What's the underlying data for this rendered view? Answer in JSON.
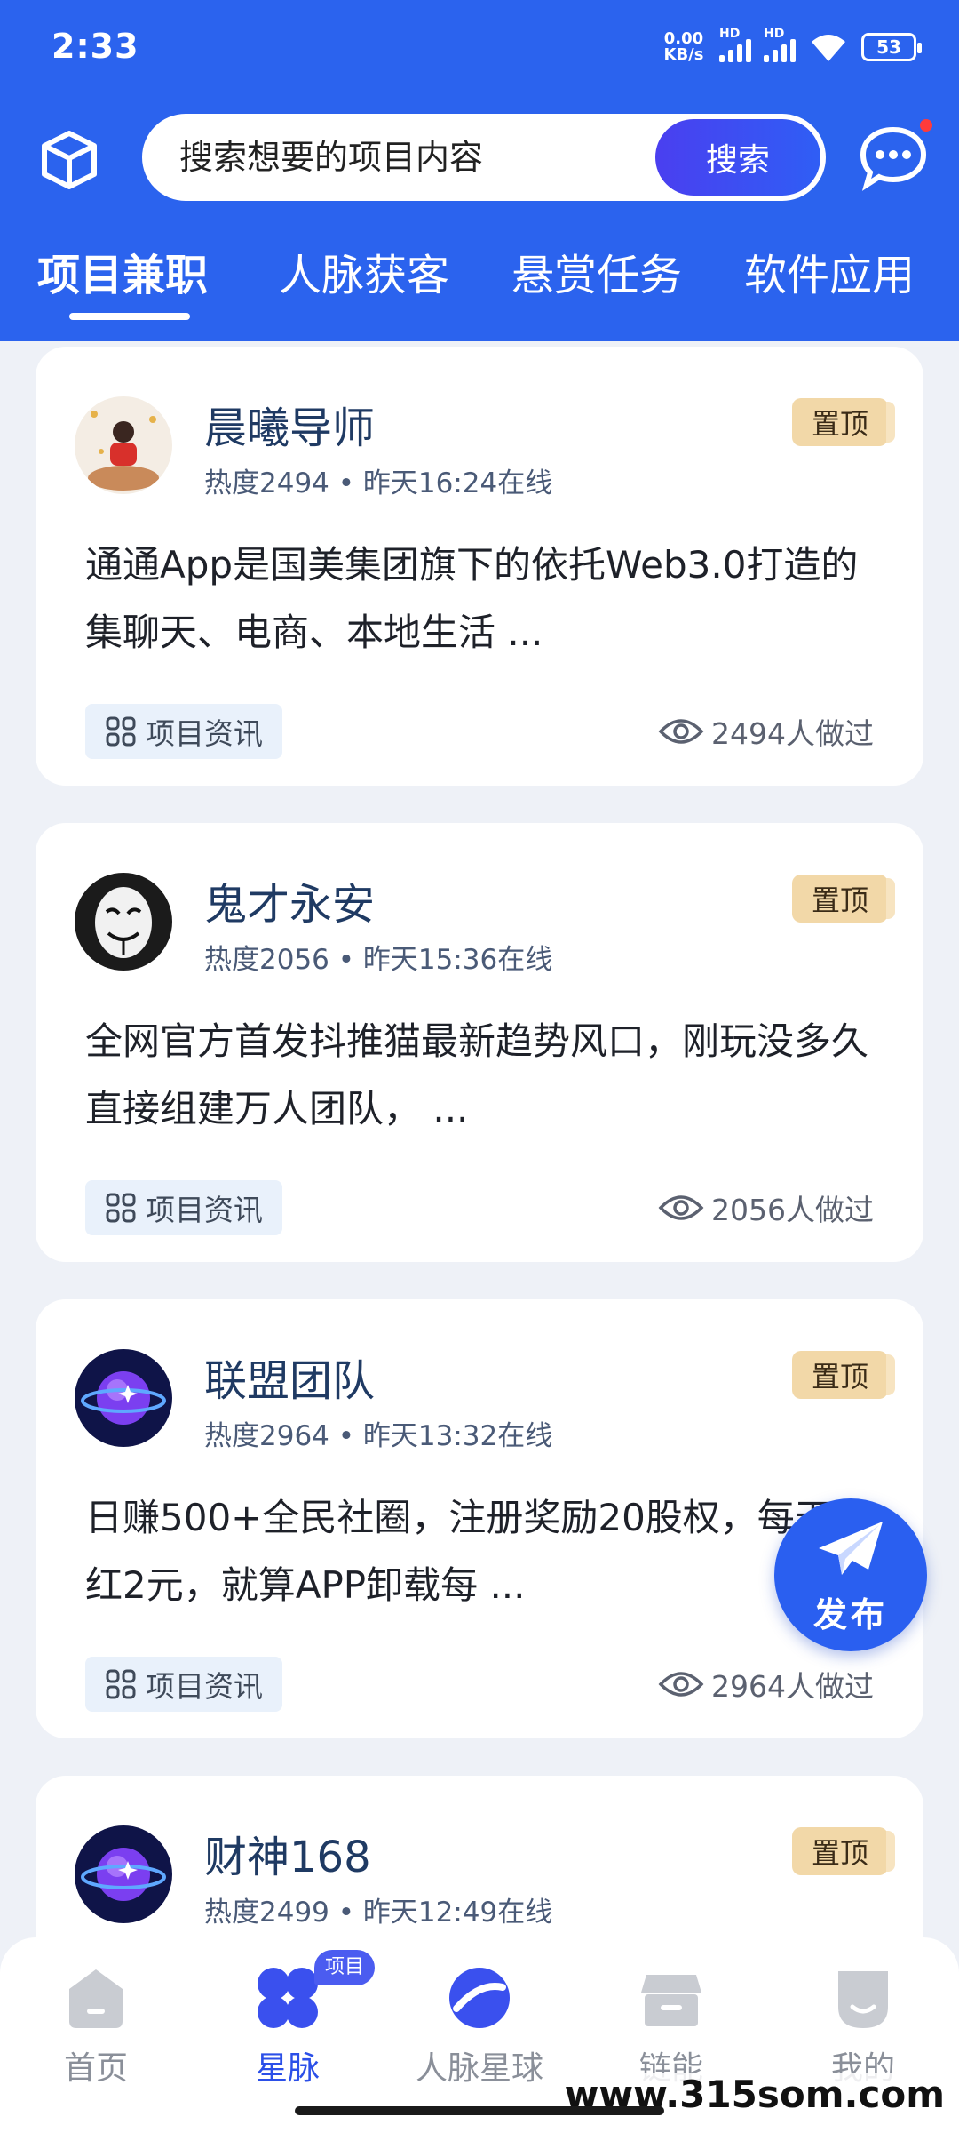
{
  "status_bar": {
    "time": "2:33",
    "netspeed_value": "0.00",
    "netspeed_unit": "KB/s",
    "signal_hd_1": "HD",
    "signal_hd_2": "HD",
    "battery": "53"
  },
  "search": {
    "placeholder": "搜索想要的项目内容",
    "button": "搜索"
  },
  "tabs": [
    {
      "label": "项目兼职"
    },
    {
      "label": "人脉获客"
    },
    {
      "label": "悬赏任务"
    },
    {
      "label": "软件应用"
    }
  ],
  "cards": [
    {
      "name": "晨曦导师",
      "meta": "热度2494 • 昨天16:24在线",
      "pin": "置顶",
      "desc": "通通App是国美集团旗下的依托Web3.0打造的集聊天、电商、本地生活 ...",
      "tag": "项目资讯",
      "views": "2494人做过"
    },
    {
      "name": "鬼才永安",
      "meta": "热度2056 • 昨天15:36在线",
      "pin": "置顶",
      "desc": "全网官方首发抖推猫最新趋势风口，刚玩没多久直接组建万人团队， ...",
      "tag": "项目资讯",
      "views": "2056人做过"
    },
    {
      "name": "联盟团队",
      "meta": "热度2964 • 昨天13:32在线",
      "pin": "置顶",
      "desc": "日赚500+全民社圈，注册奖励20股权，每天分红2元，就算APP卸载每 ...",
      "tag": "项目资讯",
      "views": "2964人做过"
    },
    {
      "name": "财神168",
      "meta": "热度2499 • 昨天12:49在线",
      "pin": "置顶"
    }
  ],
  "fab": {
    "label": "发布"
  },
  "bottom_nav": [
    {
      "label": "首页"
    },
    {
      "label": "星脉",
      "badge": "项目"
    },
    {
      "label": "人脉星球"
    },
    {
      "label": "链能"
    },
    {
      "label": "我的"
    }
  ],
  "watermark": "www.315som.com",
  "colors": {
    "brand_blue": "#2b63ee",
    "active_nav": "#2b4fe8",
    "pin_bg": "#f2d8a8"
  }
}
